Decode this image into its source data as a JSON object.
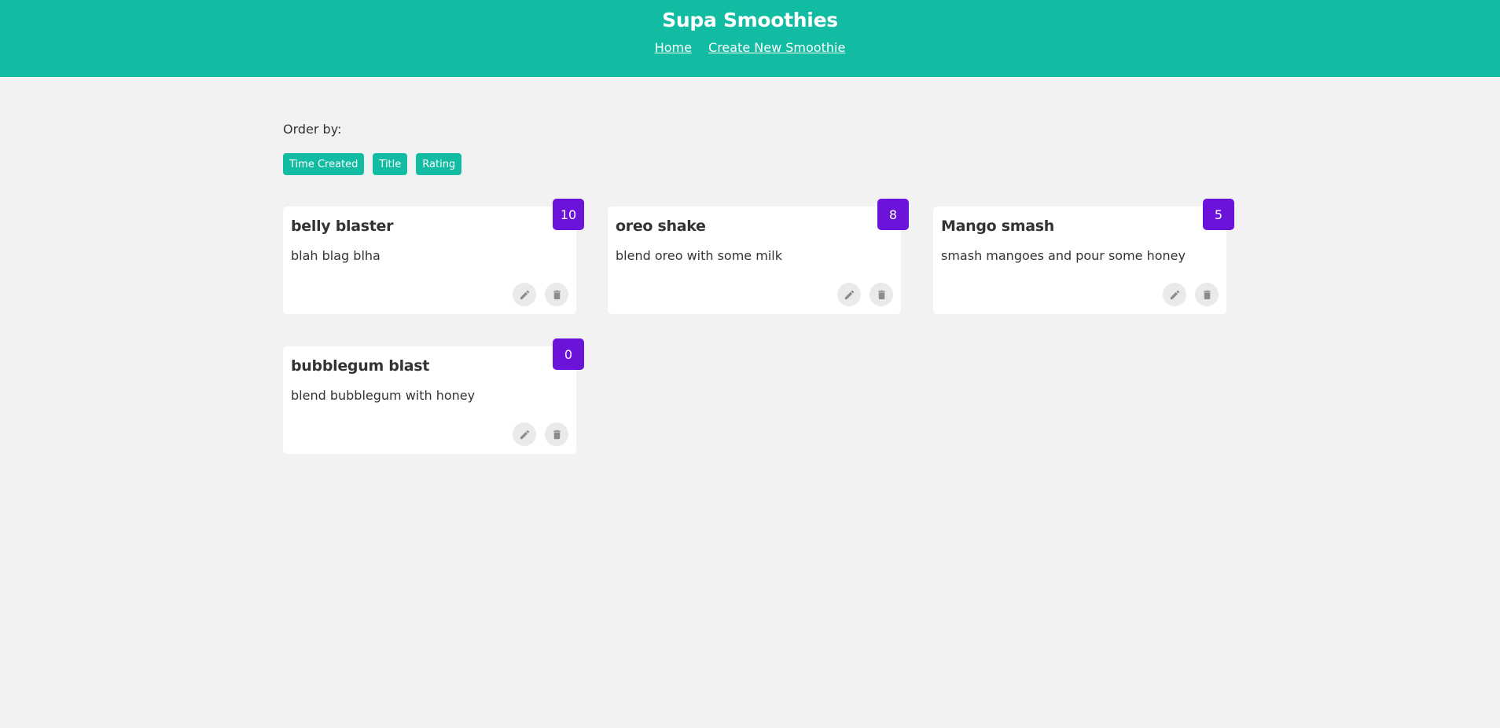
{
  "header": {
    "title": "Supa Smoothies",
    "links": [
      "Home",
      "Create New Smoothie"
    ]
  },
  "order": {
    "label": "Order by:",
    "buttons": [
      "Time Created",
      "Title",
      "Rating"
    ]
  },
  "smoothies": [
    {
      "title": "belly blaster",
      "method": "blah blag blha",
      "rating": "10"
    },
    {
      "title": "oreo shake",
      "method": "blend oreo with some milk",
      "rating": "8"
    },
    {
      "title": "Mango smash",
      "method": "smash mangoes and pour some honey",
      "rating": "5"
    },
    {
      "title": "bubblegum blast",
      "method": "blend bubblegum with honey",
      "rating": "0"
    }
  ],
  "icons": {
    "edit": "pencil-icon",
    "delete": "trash-icon"
  },
  "colors": {
    "brand": "#12bca2",
    "rating": "#6c13d9",
    "background": "#f2f2f2"
  }
}
